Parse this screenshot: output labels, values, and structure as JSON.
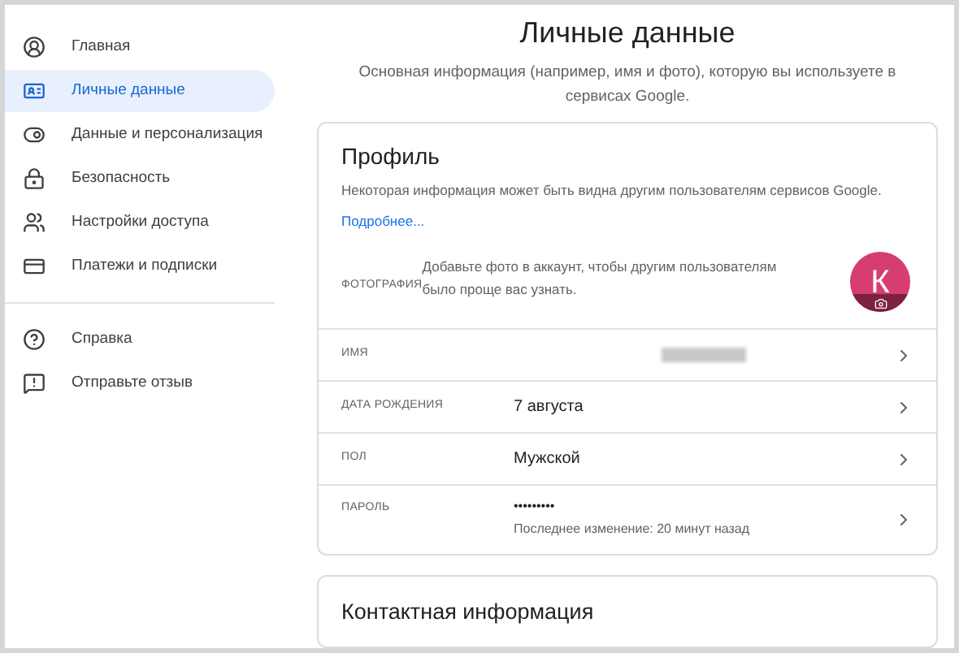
{
  "sidebar": {
    "items": [
      {
        "label": "Главная",
        "kind": "account",
        "selected": false
      },
      {
        "label": "Личные данные",
        "kind": "id",
        "selected": true
      },
      {
        "label": "Данные и персонализация",
        "kind": "toggle",
        "selected": false
      },
      {
        "label": "Безопасность",
        "kind": "lock",
        "selected": false
      },
      {
        "label": "Настройки доступа",
        "kind": "people",
        "selected": false
      },
      {
        "label": "Платежи и подписки",
        "kind": "card",
        "selected": false
      }
    ],
    "secondary_items": [
      {
        "label": "Справка",
        "kind": "help",
        "selected": false
      },
      {
        "label": "Отправьте отзыв",
        "kind": "feedback",
        "selected": false
      }
    ]
  },
  "page": {
    "title": "Личные данные",
    "subtitle": "Основная информация (например, имя и фото), которую вы используете в сервисах Google."
  },
  "profile": {
    "title": "Профиль",
    "description": "Некоторая информация может быть видна другим пользователям сервисов Google.",
    "link": "Подробнее...",
    "rows": [
      {
        "kind": "photo",
        "label": "ФОТОГРАФИЯ",
        "value": "Добавьте фото в аккаунт, чтобы другим пользователям было проще вас узнать.",
        "avatar_letter": "К"
      },
      {
        "kind": "blurred",
        "label": "ИМЯ"
      },
      {
        "kind": "text",
        "label": "ДАТА РОЖДЕНИЯ",
        "value": "7 августа"
      },
      {
        "kind": "text",
        "label": "ПОЛ",
        "value": "Мужской"
      },
      {
        "kind": "password",
        "label": "ПАРОЛЬ",
        "value": "•••••••••",
        "note": "Последнее изменение: 20 минут назад"
      }
    ]
  },
  "contact": {
    "title": "Контактная информация"
  }
}
